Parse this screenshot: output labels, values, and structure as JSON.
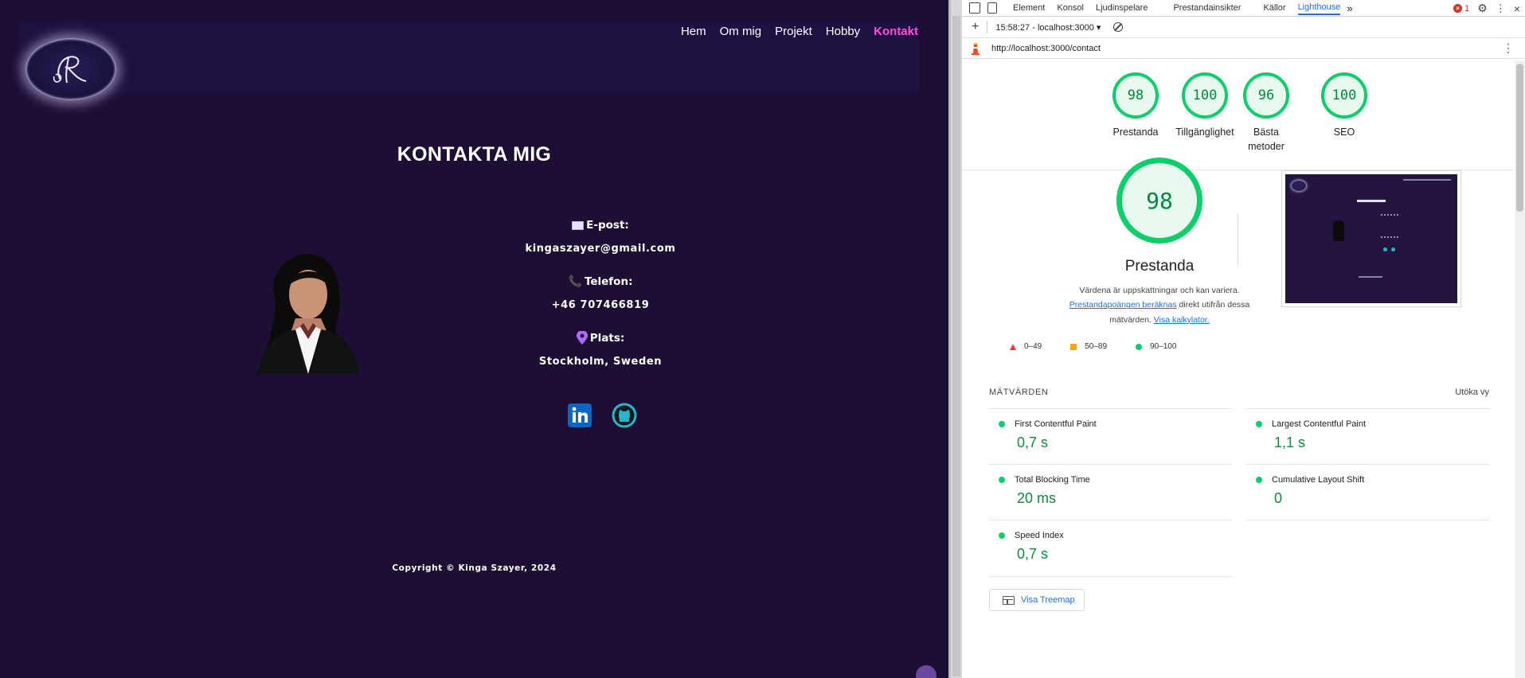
{
  "site": {
    "nav": [
      {
        "label": "Hem",
        "active": false
      },
      {
        "label": "Om mig",
        "active": false
      },
      {
        "label": "Projekt",
        "active": false
      },
      {
        "label": "Hobby",
        "active": false
      },
      {
        "label": "Kontakt",
        "active": true
      }
    ],
    "page_title": "KONTAKTA MIG",
    "contact": {
      "email_label": "E-post:",
      "email_value": "kingaszayer@gmail.com",
      "phone_label": "Telefon:",
      "phone_value": "+46 707466819",
      "location_label": "Plats:",
      "location_value": "Stockholm, Sweden"
    },
    "socials": [
      "linkedin-icon",
      "github-icon"
    ],
    "copyright": "Copyright © Kinga Szayer, 2024",
    "accent_color": "#ff4fd8",
    "background_color": "#1d0f33"
  },
  "devtools": {
    "tabs": [
      "Element",
      "Konsol",
      "Ljudinspelare",
      "Prestandainsikter",
      "Källor",
      "Lighthouse"
    ],
    "active_tab": "Lighthouse",
    "error_count": "1",
    "session": "15:58:27 - localhost:3000 ▾",
    "url": "http://localhost:3000/contact",
    "scores": [
      {
        "value": "98",
        "label": "Prestanda"
      },
      {
        "value": "100",
        "label": "Tillgänglighet"
      },
      {
        "value": "96",
        "label": "Bästa metoder"
      },
      {
        "value": "100",
        "label": "SEO"
      }
    ],
    "main_score": {
      "value": "98",
      "label": "Prestanda",
      "desc_prefix": "Värdena är uppskattningar och kan variera.",
      "desc_link1": "Prestandapoängen beräknas",
      "desc_mid": "direkt utifrån dessa mätvärden.",
      "desc_link2": "Visa kalkylator."
    },
    "legend": [
      "0–49",
      "50–89",
      "90–100"
    ],
    "metrics_title": "MÄTVÄRDEN",
    "expand_label": "Utöka vy",
    "metrics": [
      {
        "name": "First Contentful Paint",
        "value": "0,7 s"
      },
      {
        "name": "Largest Contentful Paint",
        "value": "1,1 s"
      },
      {
        "name": "Total Blocking Time",
        "value": "20 ms"
      },
      {
        "name": "Cumulative Layout Shift",
        "value": "0"
      },
      {
        "name": "Speed Index",
        "value": "0,7 s"
      }
    ],
    "treemap_label": "Visa Treemap",
    "good_color": "#0cce6b"
  }
}
